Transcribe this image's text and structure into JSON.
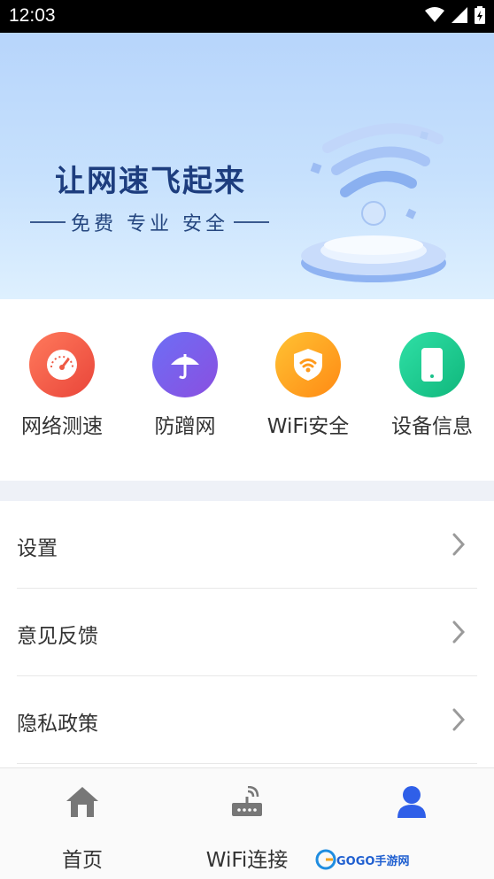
{
  "status_bar": {
    "time": "12:03"
  },
  "banner": {
    "title": "让网速飞起来",
    "subtitle": "免费 专业 安全"
  },
  "features": [
    {
      "label": "网络测速",
      "icon": "speedometer-icon",
      "color_from": "#ff7a5c",
      "color_to": "#e9453a"
    },
    {
      "label": "防蹭网",
      "icon": "umbrella-icon",
      "color_from": "#6d6ef5",
      "color_to": "#8a4fe0"
    },
    {
      "label": "WiFi安全",
      "icon": "wifi-shield-icon",
      "color_from": "#ffc233",
      "color_to": "#ff8a14"
    },
    {
      "label": "设备信息",
      "icon": "phone-icon",
      "color_from": "#2fe0a6",
      "color_to": "#10b77c"
    }
  ],
  "menu": [
    {
      "label": "设置"
    },
    {
      "label": "意见反馈"
    },
    {
      "label": "隐私政策"
    }
  ],
  "tabbar": {
    "tabs": [
      {
        "label": "首页",
        "icon": "home-icon"
      },
      {
        "label": "WiFi连接",
        "icon": "router-icon"
      },
      {
        "label": "",
        "icon": "user-icon",
        "active": true
      }
    ],
    "active_color": "#2f5fe8"
  },
  "watermark": {
    "text": "GOGO手游网"
  }
}
